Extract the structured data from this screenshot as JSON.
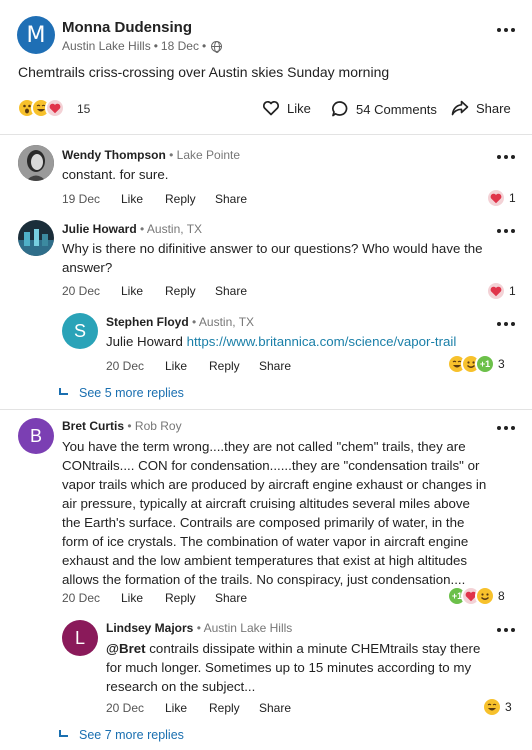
{
  "post": {
    "avatar_letter": "M",
    "avatar_color": "#1f6fb5",
    "author": "Monna Dudensing",
    "location": "Austin Lake Hills",
    "date": "18 Dec",
    "text": "Chemtrails criss-crossing over Austin skies Sunday morning",
    "reaction_count": "15",
    "like_label": "Like",
    "comments_label": "54 Comments",
    "share_label": "Share"
  },
  "comments": [
    {
      "name": "Wendy Thompson",
      "location": "Lake Pointe",
      "text": "constant.  for sure.",
      "date": "19 Dec",
      "like": "Like",
      "reply": "Reply",
      "share": "Share",
      "reaction_count": "1"
    },
    {
      "name": "Julie Howard",
      "location": "Austin, TX",
      "text": "Why is there no difinitive answer to our questions? Who would have the answer?",
      "date": "20 Dec",
      "like": "Like",
      "reply": "Reply",
      "share": "Share",
      "reaction_count": "1"
    },
    {
      "name": "Bret Curtis",
      "avatar_letter": "B",
      "avatar_color": "#7b3fb3",
      "location": "Rob Roy",
      "text": "You have the term wrong....they are not called \"chem\" trails, they are CONtrails.... CON for condensation......they are \"condensation trails\" or vapor trails which are produced by aircraft engine exhaust or changes in air pressure, typically at aircraft cruising altitudes several miles above the Earth's surface. Contrails are composed primarily of water, in the form of ice crystals. The combination of water vapor in aircraft engine exhaust and the low ambient temperatures that exist at high altitudes allows the formation of the trails. No conspiracy, just condensation....",
      "date": "20 Dec",
      "like": "Like",
      "reply": "Reply",
      "share": "Share",
      "reaction_count": "8"
    }
  ],
  "replies": [
    {
      "name": "Stephen Floyd",
      "avatar_letter": "S",
      "avatar_color": "#2aa3b8",
      "location": "Austin, TX",
      "mention": "Julie Howard",
      "link": "https://www.britannica.com/science/vapor-trail",
      "date": "20 Dec",
      "like": "Like",
      "reply": "Reply",
      "share": "Share",
      "reaction_count": "3"
    },
    {
      "name": "Lindsey Majors",
      "avatar_letter": "L",
      "avatar_color": "#8a1a5a",
      "location": "Austin Lake Hills",
      "mention": "@Bret",
      "text": " contrails dissipate within a minute CHEMtrails stay there for much longer. Sometimes up to 15 minutes according to my research on the subject...",
      "date": "20 Dec",
      "like": "Like",
      "reply": "Reply",
      "share": "Share",
      "reaction_count": "3"
    }
  ],
  "see_more_1": "See 5 more replies",
  "see_more_2": "See 7 more replies",
  "separator": "•",
  "plus_one": "+1"
}
